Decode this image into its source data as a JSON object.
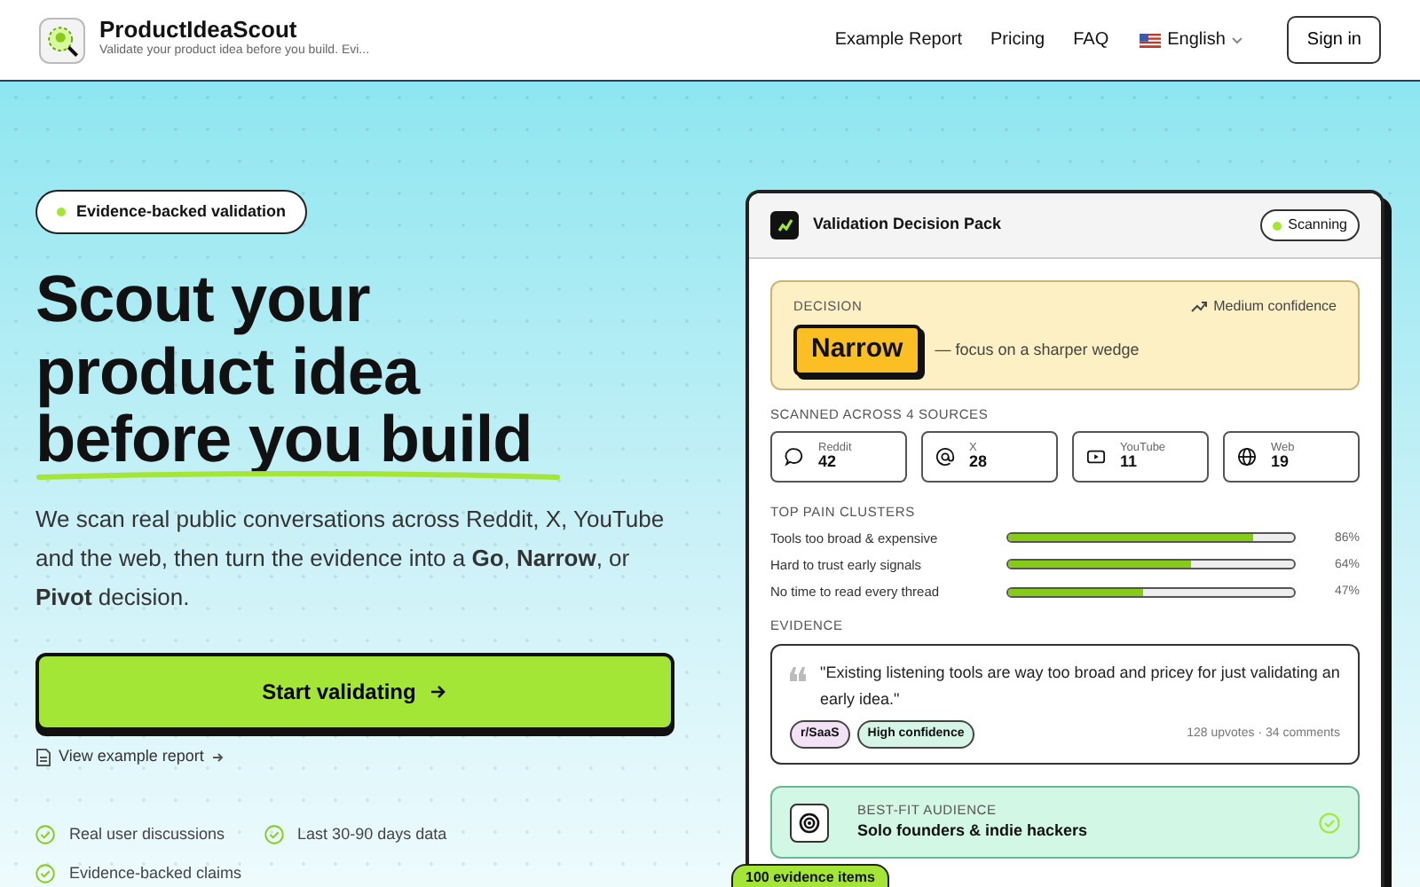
{
  "header": {
    "brand": "ProductIdeaScout",
    "tagline": "Validate your product idea before you build. Evi...",
    "nav": [
      "Example Report",
      "Pricing",
      "FAQ"
    ],
    "language": "English",
    "sign_in": "Sign in"
  },
  "hero": {
    "badge": "Evidence-backed validation",
    "headline": [
      "Scout your",
      "product idea",
      "before you build"
    ],
    "intro": "We scan real public conversations across Reddit, X, YouTube and the web, then turn the evidence into a **Go**, **Narrow**, or **Pivot** decision.",
    "cta": "Start validating",
    "secondary_link": "View example report",
    "features": [
      "Real user discussions",
      "Last 30-90 days data",
      "Evidence-backed claims"
    ]
  },
  "card": {
    "title": "Validation Decision Pack",
    "status": "Scanning",
    "decision": {
      "label": "DECISION",
      "confidence": "Medium confidence",
      "verdict": "Narrow",
      "note": "— focus on a sharper wedge"
    },
    "sources_heading": "SCANNED ACROSS 4 SOURCES",
    "sources": [
      {
        "name": "Reddit",
        "count": "42"
      },
      {
        "name": "X",
        "count": "28"
      },
      {
        "name": "YouTube",
        "count": "11"
      },
      {
        "name": "Web",
        "count": "19"
      }
    ],
    "clusters_heading": "TOP PAIN CLUSTERS",
    "clusters": [
      {
        "label": "Tools too broad & expensive",
        "level": 0.86,
        "reading": "86%"
      },
      {
        "label": "Hard to trust early signals",
        "level": 0.64,
        "reading": "64%"
      },
      {
        "label": "No time to read every thread",
        "level": 0.47,
        "reading": "47%"
      }
    ],
    "evidence_heading": "EVIDENCE",
    "quote": "\"Existing listening tools are way too broad and pricey for just validating an early idea.\"",
    "tags": [
      {
        "label": "r/SaaS",
        "color": "#f3e1f5"
      },
      {
        "label": "High confidence",
        "color": "#d5f5e6"
      }
    ],
    "meta": "128 upvotes · 34 comments",
    "audience": {
      "label": "BEST-FIT AUDIENCE",
      "value": "Solo founders & indie hackers"
    },
    "footer_badge": "100 evidence items"
  }
}
